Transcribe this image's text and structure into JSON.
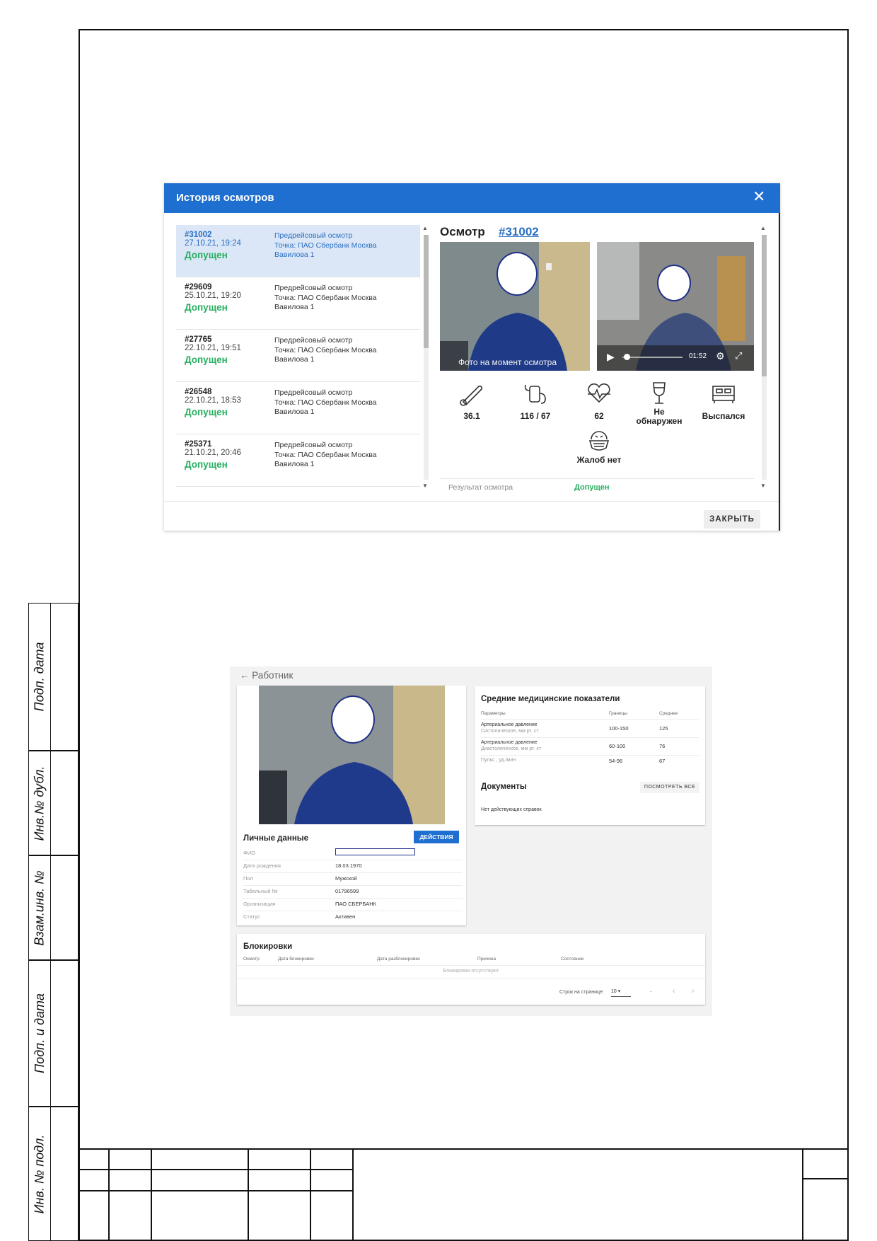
{
  "stamp_labels": [
    "Подп. дата",
    "Инв.№ дубл.",
    "Взам.инв. №",
    "Подп. и дата",
    "Инв. № подл."
  ],
  "modal": {
    "title": "История осмотров",
    "close_icon": "close-icon",
    "close_button": "ЗАКРЫТЬ",
    "exams": [
      {
        "id": "#31002",
        "date": "27.10.21, 19:24",
        "status": "Допущен",
        "type": "Предрейсовый осмотр",
        "point": "Точка: ПАО Сбербанк Москва",
        "address": "Вавилова 1"
      },
      {
        "id": "#29609",
        "date": "25.10.21, 19:20",
        "status": "Допущен",
        "type": "Предрейсовый осмотр",
        "point": "Точка: ПАО Сбербанк Москва",
        "address": "Вавилова 1"
      },
      {
        "id": "#27765",
        "date": "22.10.21, 19:51",
        "status": "Допущен",
        "type": "Предрейсовый осмотр",
        "point": "Точка: ПАО Сбербанк Москва",
        "address": "Вавилова 1"
      },
      {
        "id": "#26548",
        "date": "22.10.21, 18:53",
        "status": "Допущен",
        "type": "Предрейсовый осмотр",
        "point": "Точка: ПАО Сбербанк Москва",
        "address": "Вавилова 1"
      },
      {
        "id": "#25371",
        "date": "21.10.21, 20:46",
        "status": "Допущен",
        "type": "Предрейсовый осмотр",
        "point": "Точка: ПАО Сбербанк Москва",
        "address": "Вавилова 1"
      }
    ],
    "detail": {
      "title": "Осмотр",
      "exam_link": "#31002",
      "photo_caption": "Фото на момент осмотра",
      "video_time": "01:52",
      "metrics": [
        {
          "icon": "thermometer-icon",
          "value": "36.1"
        },
        {
          "icon": "blood-pressure-icon",
          "value": "116 / 67"
        },
        {
          "icon": "heart-pulse-icon",
          "value": "62"
        },
        {
          "icon": "wine-glass-icon",
          "value_line1": "Не",
          "value_line2": "обнаружен"
        },
        {
          "icon": "bed-icon",
          "value": "Выспался"
        },
        {
          "icon": "face-mask-icon",
          "value": "Жалоб нет"
        }
      ],
      "result_label": "Результат осмотра",
      "result_value": "Допущен"
    }
  },
  "worker": {
    "back_link": "← Работник",
    "personal": {
      "title": "Личные данные",
      "actions_button": "ДЕЙСТВИЯ",
      "rows": [
        {
          "key": "ФИО",
          "value": ""
        },
        {
          "key": "Дата рождения",
          "value": "18.03.1970"
        },
        {
          "key": "Пол",
          "value": "Мужской"
        },
        {
          "key": "Табельный №",
          "value": "01796599"
        },
        {
          "key": "Организация",
          "value": "ПАО СБЕРБАНК"
        },
        {
          "key": "Статус",
          "value": "Активен"
        }
      ]
    },
    "medical": {
      "title": "Средние медицинские показатели",
      "headers": [
        "Параметры",
        "Границы",
        "Среднее"
      ],
      "rows": [
        {
          "param": "Артериальное давление",
          "sub": "Систолическое, мм рт. ст",
          "range": "100-150",
          "avg": "125"
        },
        {
          "param": "Артериальное давление",
          "sub": "Диастолическое, мм рт. ст",
          "range": "60-100",
          "avg": "76"
        },
        {
          "param": "Пульс , уд./мин",
          "sub": "",
          "range": "54-96",
          "avg": "67"
        }
      ]
    },
    "documents": {
      "title": "Документы",
      "view_all": "ПОСМОТРЕТЬ ВСЕ",
      "empty": "Нет действующих справок"
    },
    "blocks": {
      "title": "Блокировки",
      "headers": [
        "Осмотр",
        "Дата блокировки",
        "Дата разблокировки",
        "Причина",
        "Состояние"
      ],
      "empty": "Блокировки отсутствуют",
      "rows_label": "Строк на странице:",
      "rows_value": "10",
      "range": "-"
    }
  }
}
